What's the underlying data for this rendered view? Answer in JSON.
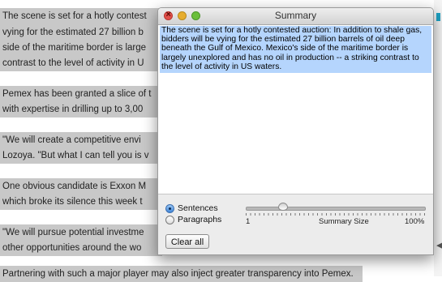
{
  "article": {
    "lines": [
      "The scene is set for a hotly contest",
      "vying for the estimated 27 billion b",
      "side of the maritime border is large",
      "contrast to the level of activity in U",
      "Pemex has been granted a slice of t",
      "with expertise in drilling up to 3,00",
      "\"We will create a competitive envi",
      "Lozoya. \"But what I can tell you is v",
      "One obvious candidate is Exxon M",
      "which broke its silence this week t",
      "\"We will pursue potential investme",
      "other opportunities around the wo",
      "Partnering with such a major player may also inject greater transparency into Pemex."
    ]
  },
  "window": {
    "title": "Summary",
    "summary_text": "The scene is set for a hotly contested auction: In addition to shale gas, bidders will be vying for the estimated 27 billion barrels of oil deep beneath the Gulf of Mexico. Mexico's side of the maritime border is largely unexplored and has no oil in production -- a striking contrast to the level of activity in US waters."
  },
  "controls": {
    "mode_options": [
      "Sentences",
      "Paragraphs"
    ],
    "selected_mode": "Sentences",
    "slider": {
      "min_label": "1",
      "caption": "Summary Size",
      "max_label": "100%",
      "value_fraction": 0.2
    },
    "clear_button": "Clear all"
  },
  "colors": {
    "selection_highlight": "#b5d5fd",
    "window_background": "#ececec",
    "article_highlight": "#c8c8c8",
    "accent": "#1ea4c6"
  }
}
